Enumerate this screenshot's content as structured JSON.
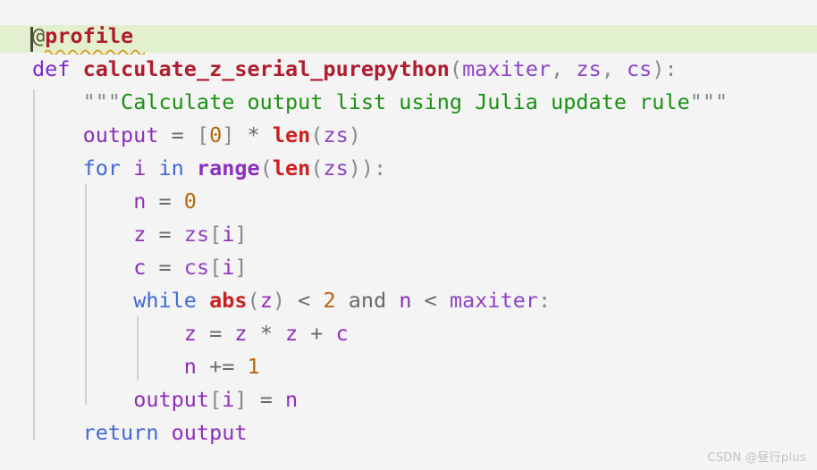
{
  "editor": {
    "background_color": "#f4f4f4",
    "language": "python",
    "current_line_highlight_color": "#e2f0d0",
    "indent_guide_color": "#d0d0d0",
    "caret_color": "#4a4a42",
    "error_squiggle_color": "#d79b1a"
  },
  "code": {
    "line1": {
      "decorator_at": "@",
      "decorator_name": "profile"
    },
    "line2": {
      "kw_def": "def",
      "space1": " ",
      "func_name": "calculate_z_serial_purepython",
      "paren_open": "(",
      "param1": "maxiter",
      "comma1": ", ",
      "param2": "zs",
      "comma2": ", ",
      "param3": "cs",
      "paren_close": ")",
      "colon": ":"
    },
    "line3": {
      "indent": "    ",
      "quote_open": "\"\"\"",
      "docstring": "Calculate output list using Julia update rule",
      "quote_close": "\"\"\""
    },
    "line4": {
      "indent": "    ",
      "var": "output",
      "eq": " = ",
      "bracket_open": "[",
      "number": "0",
      "bracket_close": "]",
      "star": " * ",
      "builtin": "len",
      "paren_open": "(",
      "arg": "zs",
      "paren_close": ")"
    },
    "line5": {
      "indent": "    ",
      "kw_for": "for",
      "loopvar": " i ",
      "kw_in": "in",
      "space": " ",
      "range_fn": "range",
      "paren_open": "(",
      "len_fn": "len",
      "paren_open2": "(",
      "arg": "zs",
      "paren_close2": ")",
      "paren_close": ")",
      "colon": ":"
    },
    "line6": {
      "indent": "        ",
      "var": "n",
      "eq": " = ",
      "number": "0"
    },
    "line7": {
      "indent": "        ",
      "var": "z",
      "eq": " = ",
      "src": "zs",
      "bracket_open": "[",
      "index": "i",
      "bracket_close": "]"
    },
    "line8": {
      "indent": "        ",
      "var": "c",
      "eq": " = ",
      "src": "cs",
      "bracket_open": "[",
      "index": "i",
      "bracket_close": "]"
    },
    "line9": {
      "indent": "        ",
      "kw_while": "while",
      "space": " ",
      "builtin": "abs",
      "paren_open": "(",
      "arg": "z",
      "paren_close": ")",
      "lt1": " < ",
      "number": "2",
      "kw_and": " and ",
      "var": "n",
      "lt2": " < ",
      "var2": "maxiter",
      "colon": ":"
    },
    "line10": {
      "indent": "            ",
      "var": "z",
      "eq": " = ",
      "a": "z",
      "mul": " * ",
      "b": "z",
      "plus": " + ",
      "c": "c"
    },
    "line11": {
      "indent": "            ",
      "var": "n",
      "op": " += ",
      "number": "1"
    },
    "line12": {
      "indent": "        ",
      "var": "output",
      "bracket_open": "[",
      "index": "i",
      "bracket_close": "]",
      "eq": " = ",
      "rhs": "n"
    },
    "line13": {
      "indent": "    ",
      "kw_return": "return",
      "space": " ",
      "var": "output"
    }
  },
  "watermark": {
    "text": "CSDN @昼行plus"
  }
}
